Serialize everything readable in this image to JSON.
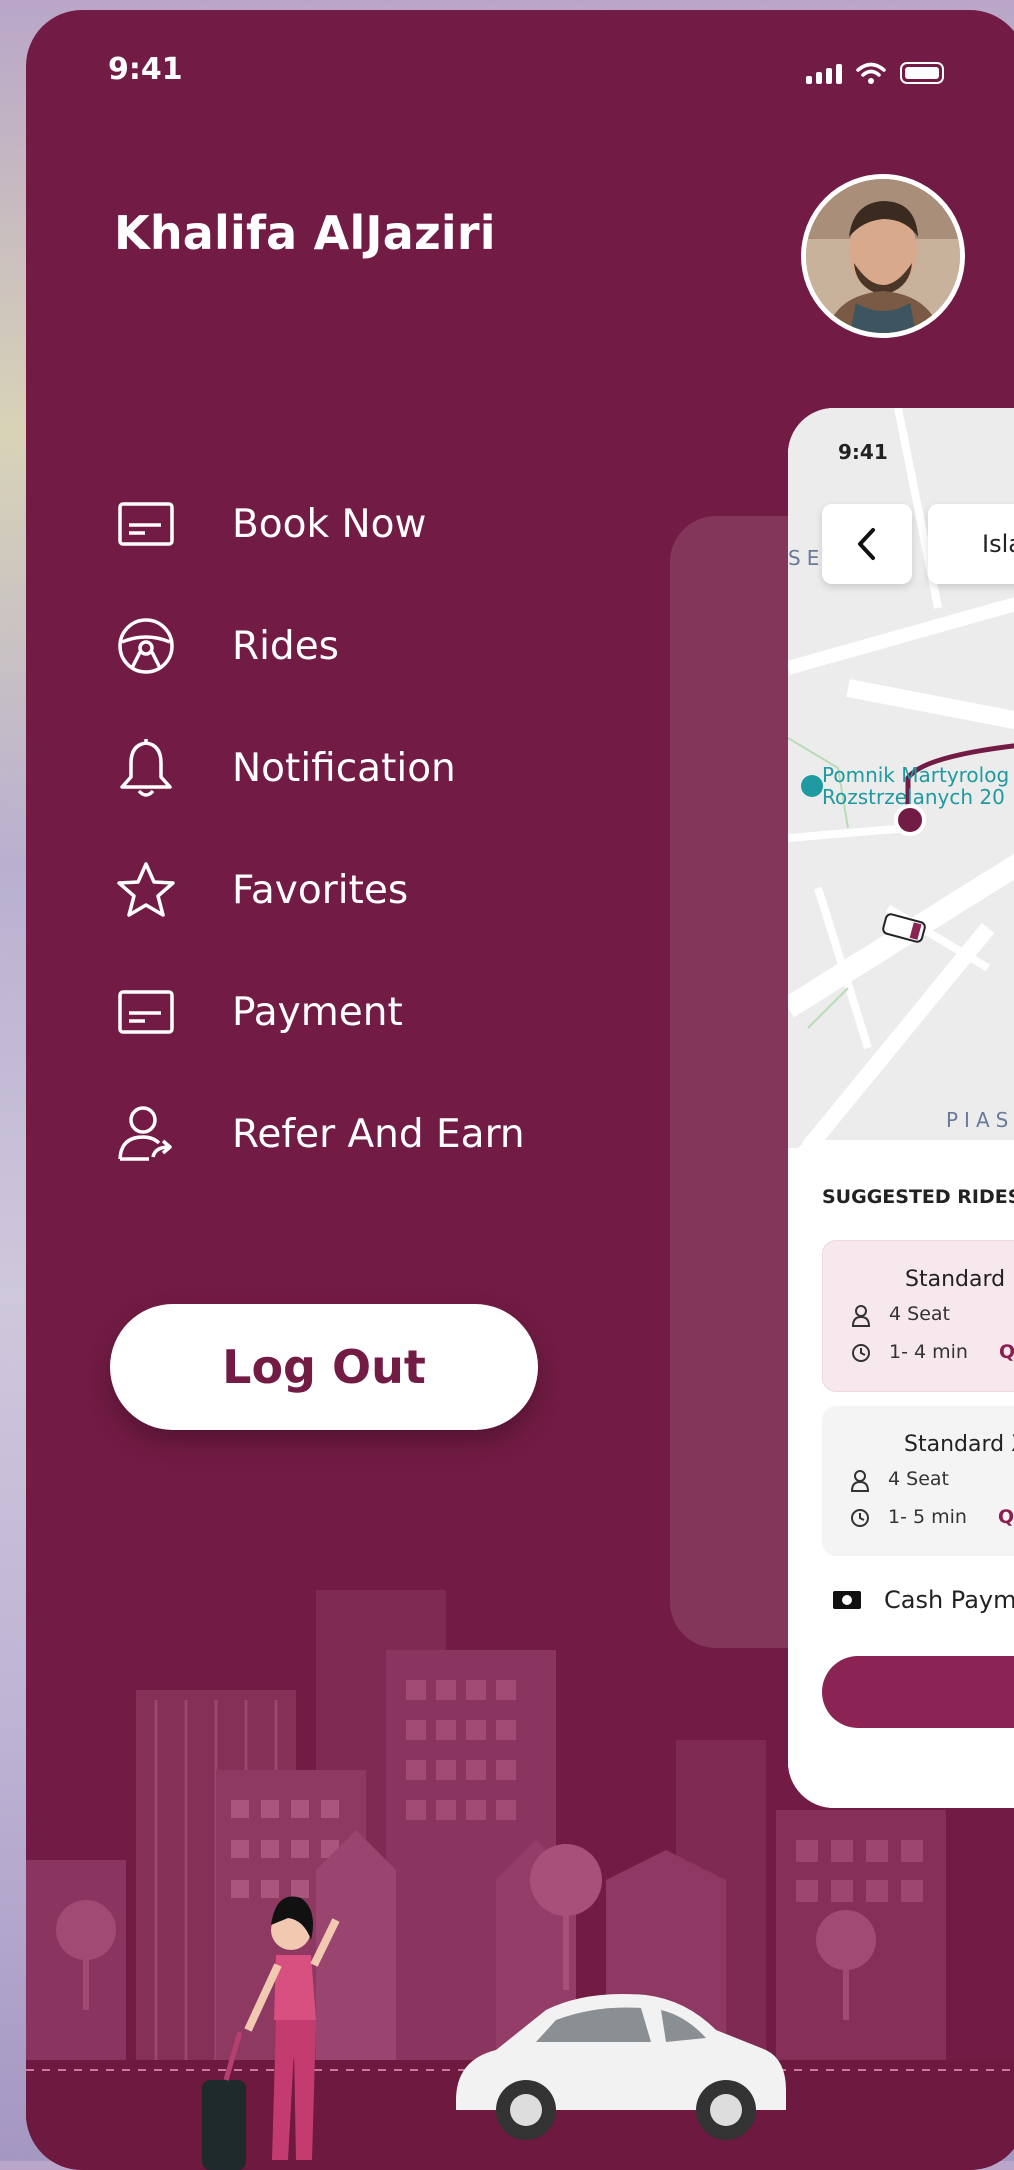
{
  "status": {
    "time": "9:41"
  },
  "user": {
    "name": "Khalifa AlJaziri"
  },
  "menu": [
    {
      "label": "Book Now",
      "icon": "card-icon"
    },
    {
      "label": "Rides",
      "icon": "steering-wheel-icon"
    },
    {
      "label": "Notification",
      "icon": "bell-icon"
    },
    {
      "label": "Favorites",
      "icon": "star-icon"
    },
    {
      "label": "Payment",
      "icon": "card-icon"
    },
    {
      "label": "Refer And Earn",
      "icon": "user-share-icon"
    }
  ],
  "logout_label": "Log Out",
  "preview": {
    "time": "9:41",
    "search_text": "Isla",
    "map_labels": {
      "top": "SE",
      "bottom": "PIAS",
      "poi": "Pomnik Martyrolog",
      "poi2": "Rozstrzelanych 20"
    },
    "suggested_title": "SUGGESTED RIDES",
    "rides": [
      {
        "name": "Standard",
        "seats": "4 Seat",
        "eta": "1- 4 min",
        "price": "Q"
      },
      {
        "name": "Standard X",
        "seats": "4 Seat",
        "eta": "1- 5 min",
        "price": "Q"
      }
    ],
    "payment": "Cash Paym"
  },
  "colors": {
    "primary": "#721b44",
    "accent": "#8b2354",
    "white": "#ffffff"
  }
}
